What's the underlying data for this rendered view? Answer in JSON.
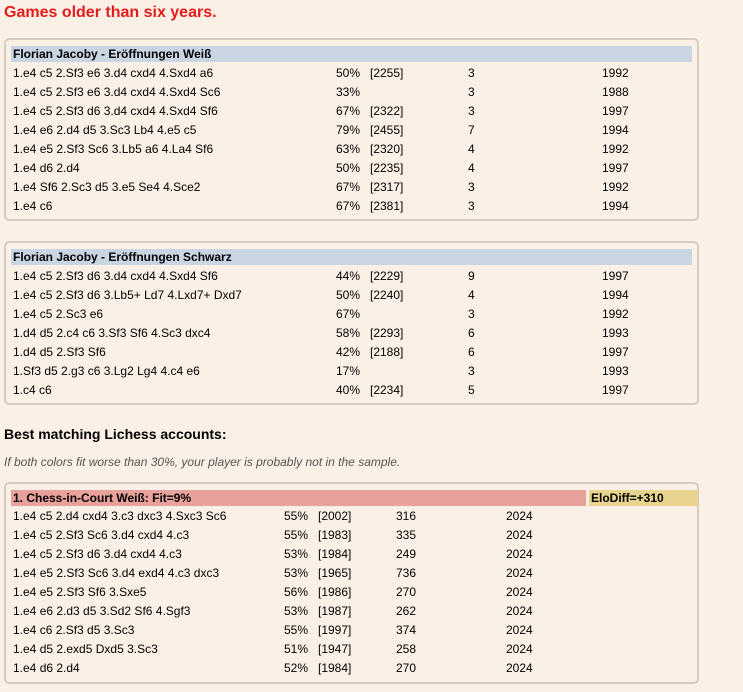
{
  "warning": "Games older than six years.",
  "white_openings": {
    "title": "Florian Jacoby - Eröffnungen Weiß",
    "rows": [
      {
        "moves": "1.e4 c5 2.Sf3 e6 3.d4 cxd4 4.Sxd4 a6",
        "pct": "50%",
        "elo": "[2255]",
        "games": "3",
        "year": "1992"
      },
      {
        "moves": "1.e4 c5 2.Sf3 e6 3.d4 cxd4 4.Sxd4 Sc6",
        "pct": "33%",
        "elo": "",
        "games": "3",
        "year": "1988"
      },
      {
        "moves": "1.e4 c5 2.Sf3 d6 3.d4 cxd4 4.Sxd4 Sf6",
        "pct": "67%",
        "elo": "[2322]",
        "games": "3",
        "year": "1997"
      },
      {
        "moves": "1.e4 e6 2.d4 d5 3.Sc3 Lb4 4.e5 c5",
        "pct": "79%",
        "elo": "[2455]",
        "games": "7",
        "year": "1994"
      },
      {
        "moves": "1.e4 e5 2.Sf3 Sc6 3.Lb5 a6 4.La4 Sf6",
        "pct": "63%",
        "elo": "[2320]",
        "games": "4",
        "year": "1992"
      },
      {
        "moves": "1.e4 d6 2.d4",
        "pct": "50%",
        "elo": "[2235]",
        "games": "4",
        "year": "1997"
      },
      {
        "moves": "1.e4 Sf6 2.Sc3 d5 3.e5 Se4 4.Sce2",
        "pct": "67%",
        "elo": "[2317]",
        "games": "3",
        "year": "1992"
      },
      {
        "moves": "1.e4 c6",
        "pct": "67%",
        "elo": "[2381]",
        "games": "3",
        "year": "1994"
      }
    ]
  },
  "black_openings": {
    "title": "Florian Jacoby - Eröffnungen Schwarz",
    "rows": [
      {
        "moves": "1.e4 c5 2.Sf3 d6 3.d4 cxd4 4.Sxd4 Sf6",
        "pct": "44%",
        "elo": "[2229]",
        "games": "9",
        "year": "1997"
      },
      {
        "moves": "1.e4 c5 2.Sf3 d6 3.Lb5+ Ld7 4.Lxd7+ Dxd7",
        "pct": "50%",
        "elo": "[2240]",
        "games": "4",
        "year": "1994"
      },
      {
        "moves": "1.e4 c5 2.Sc3 e6",
        "pct": "67%",
        "elo": "",
        "games": "3",
        "year": "1992"
      },
      {
        "moves": "1.d4 d5 2.c4 c6 3.Sf3 Sf6 4.Sc3 dxc4",
        "pct": "58%",
        "elo": "[2293]",
        "games": "6",
        "year": "1993"
      },
      {
        "moves": "1.d4 d5 2.Sf3 Sf6",
        "pct": "42%",
        "elo": "[2188]",
        "games": "6",
        "year": "1997"
      },
      {
        "moves": "1.Sf3 d5 2.g3 c6 3.Lg2 Lg4 4.c4 e6",
        "pct": "17%",
        "elo": "",
        "games": "3",
        "year": "1993"
      },
      {
        "moves": "1.c4 c6",
        "pct": "40%",
        "elo": "[2234]",
        "games": "5",
        "year": "1997"
      }
    ]
  },
  "lichess": {
    "heading": "Best matching Lichess accounts:",
    "note": "If both colors fit worse than 30%, your player is probably not in the sample.",
    "account": {
      "title": "1. Chess-in-Court Weiß: Fit=9%",
      "elo_diff": "EloDiff=+310",
      "rows": [
        {
          "moves": "1.e4 c5 2.d4 cxd4 3.c3 dxc3 4.Sxc3 Sc6",
          "pct": "55%",
          "elo": "[2002]",
          "games": "316",
          "year": "2024"
        },
        {
          "moves": "1.e4 c5 2.Sf3 Sc6 3.d4 cxd4 4.c3",
          "pct": "55%",
          "elo": "[1983]",
          "games": "335",
          "year": "2024"
        },
        {
          "moves": "1.e4 c5 2.Sf3 d6 3.d4 cxd4 4.c3",
          "pct": "53%",
          "elo": "[1984]",
          "games": "249",
          "year": "2024"
        },
        {
          "moves": "1.e4 e5 2.Sf3 Sc6 3.d4 exd4 4.c3 dxc3",
          "pct": "53%",
          "elo": "[1965]",
          "games": "736",
          "year": "2024"
        },
        {
          "moves": "1.e4 e5 2.Sf3 Sf6 3.Sxe5",
          "pct": "56%",
          "elo": "[1986]",
          "games": "270",
          "year": "2024"
        },
        {
          "moves": "1.e4 e6 2.d3 d5 3.Sd2 Sf6 4.Sgf3",
          "pct": "53%",
          "elo": "[1987]",
          "games": "262",
          "year": "2024"
        },
        {
          "moves": "1.e4 c6 2.Sf3 d5 3.Sc3",
          "pct": "55%",
          "elo": "[1997]",
          "games": "374",
          "year": "2024"
        },
        {
          "moves": "1.e4 d5 2.exd5 Dxd5 3.Sc3",
          "pct": "51%",
          "elo": "[1947]",
          "games": "258",
          "year": "2024"
        },
        {
          "moves": "1.e4 d6 2.d4",
          "pct": "52%",
          "elo": "[1984]",
          "games": "270",
          "year": "2024"
        }
      ]
    }
  },
  "colors": {
    "warning": "#e41b1b",
    "table_header": "#c9d5e3",
    "account_header": "#e8a19b",
    "elo_header": "#e9d48f",
    "background": "#fbf0e6"
  }
}
